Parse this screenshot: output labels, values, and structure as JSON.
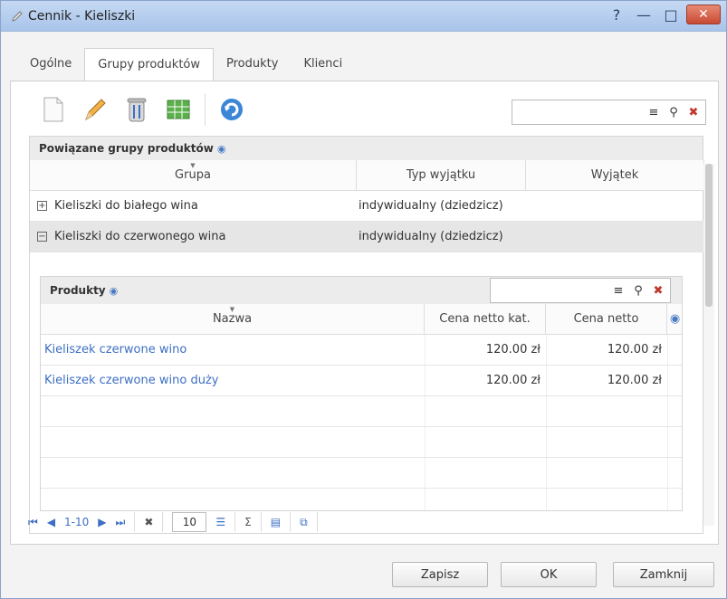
{
  "window": {
    "title": "Cennik - Kieliszki"
  },
  "tabs": [
    {
      "label": "Ogólne"
    },
    {
      "label": "Grupy produktów"
    },
    {
      "label": "Produkty"
    },
    {
      "label": "Klienci"
    }
  ],
  "groups_panel": {
    "title": "Powiązane grupy produktów",
    "columns": [
      "Grupa",
      "Typ wyjątku",
      "Wyjątek"
    ],
    "rows": [
      {
        "name": "Kieliszki do białego wina",
        "type": "indywidualny (dziedzicz)",
        "exception": ""
      },
      {
        "name": "Kieliszki do czerwonego wina",
        "type": "indywidualny (dziedzicz)",
        "exception": ""
      }
    ]
  },
  "products_panel": {
    "title": "Produkty",
    "columns": [
      "Nazwa",
      "Cena netto kat.",
      "Cena netto"
    ],
    "rows": [
      {
        "name": "Kieliszek czerwone wino",
        "catalog_price": "120.00 zł",
        "price": "120.00 zł"
      },
      {
        "name": "Kieliszek czerwone wino duży",
        "catalog_price": "120.00 zł",
        "price": "120.00 zł"
      }
    ]
  },
  "pager": {
    "range": "1-10",
    "page_size": "10"
  },
  "buttons": {
    "save": "Zapisz",
    "ok": "OK",
    "close": "Zamknij"
  },
  "colors": {
    "link": "#3d6fc2",
    "close_button": "#c94a33"
  }
}
